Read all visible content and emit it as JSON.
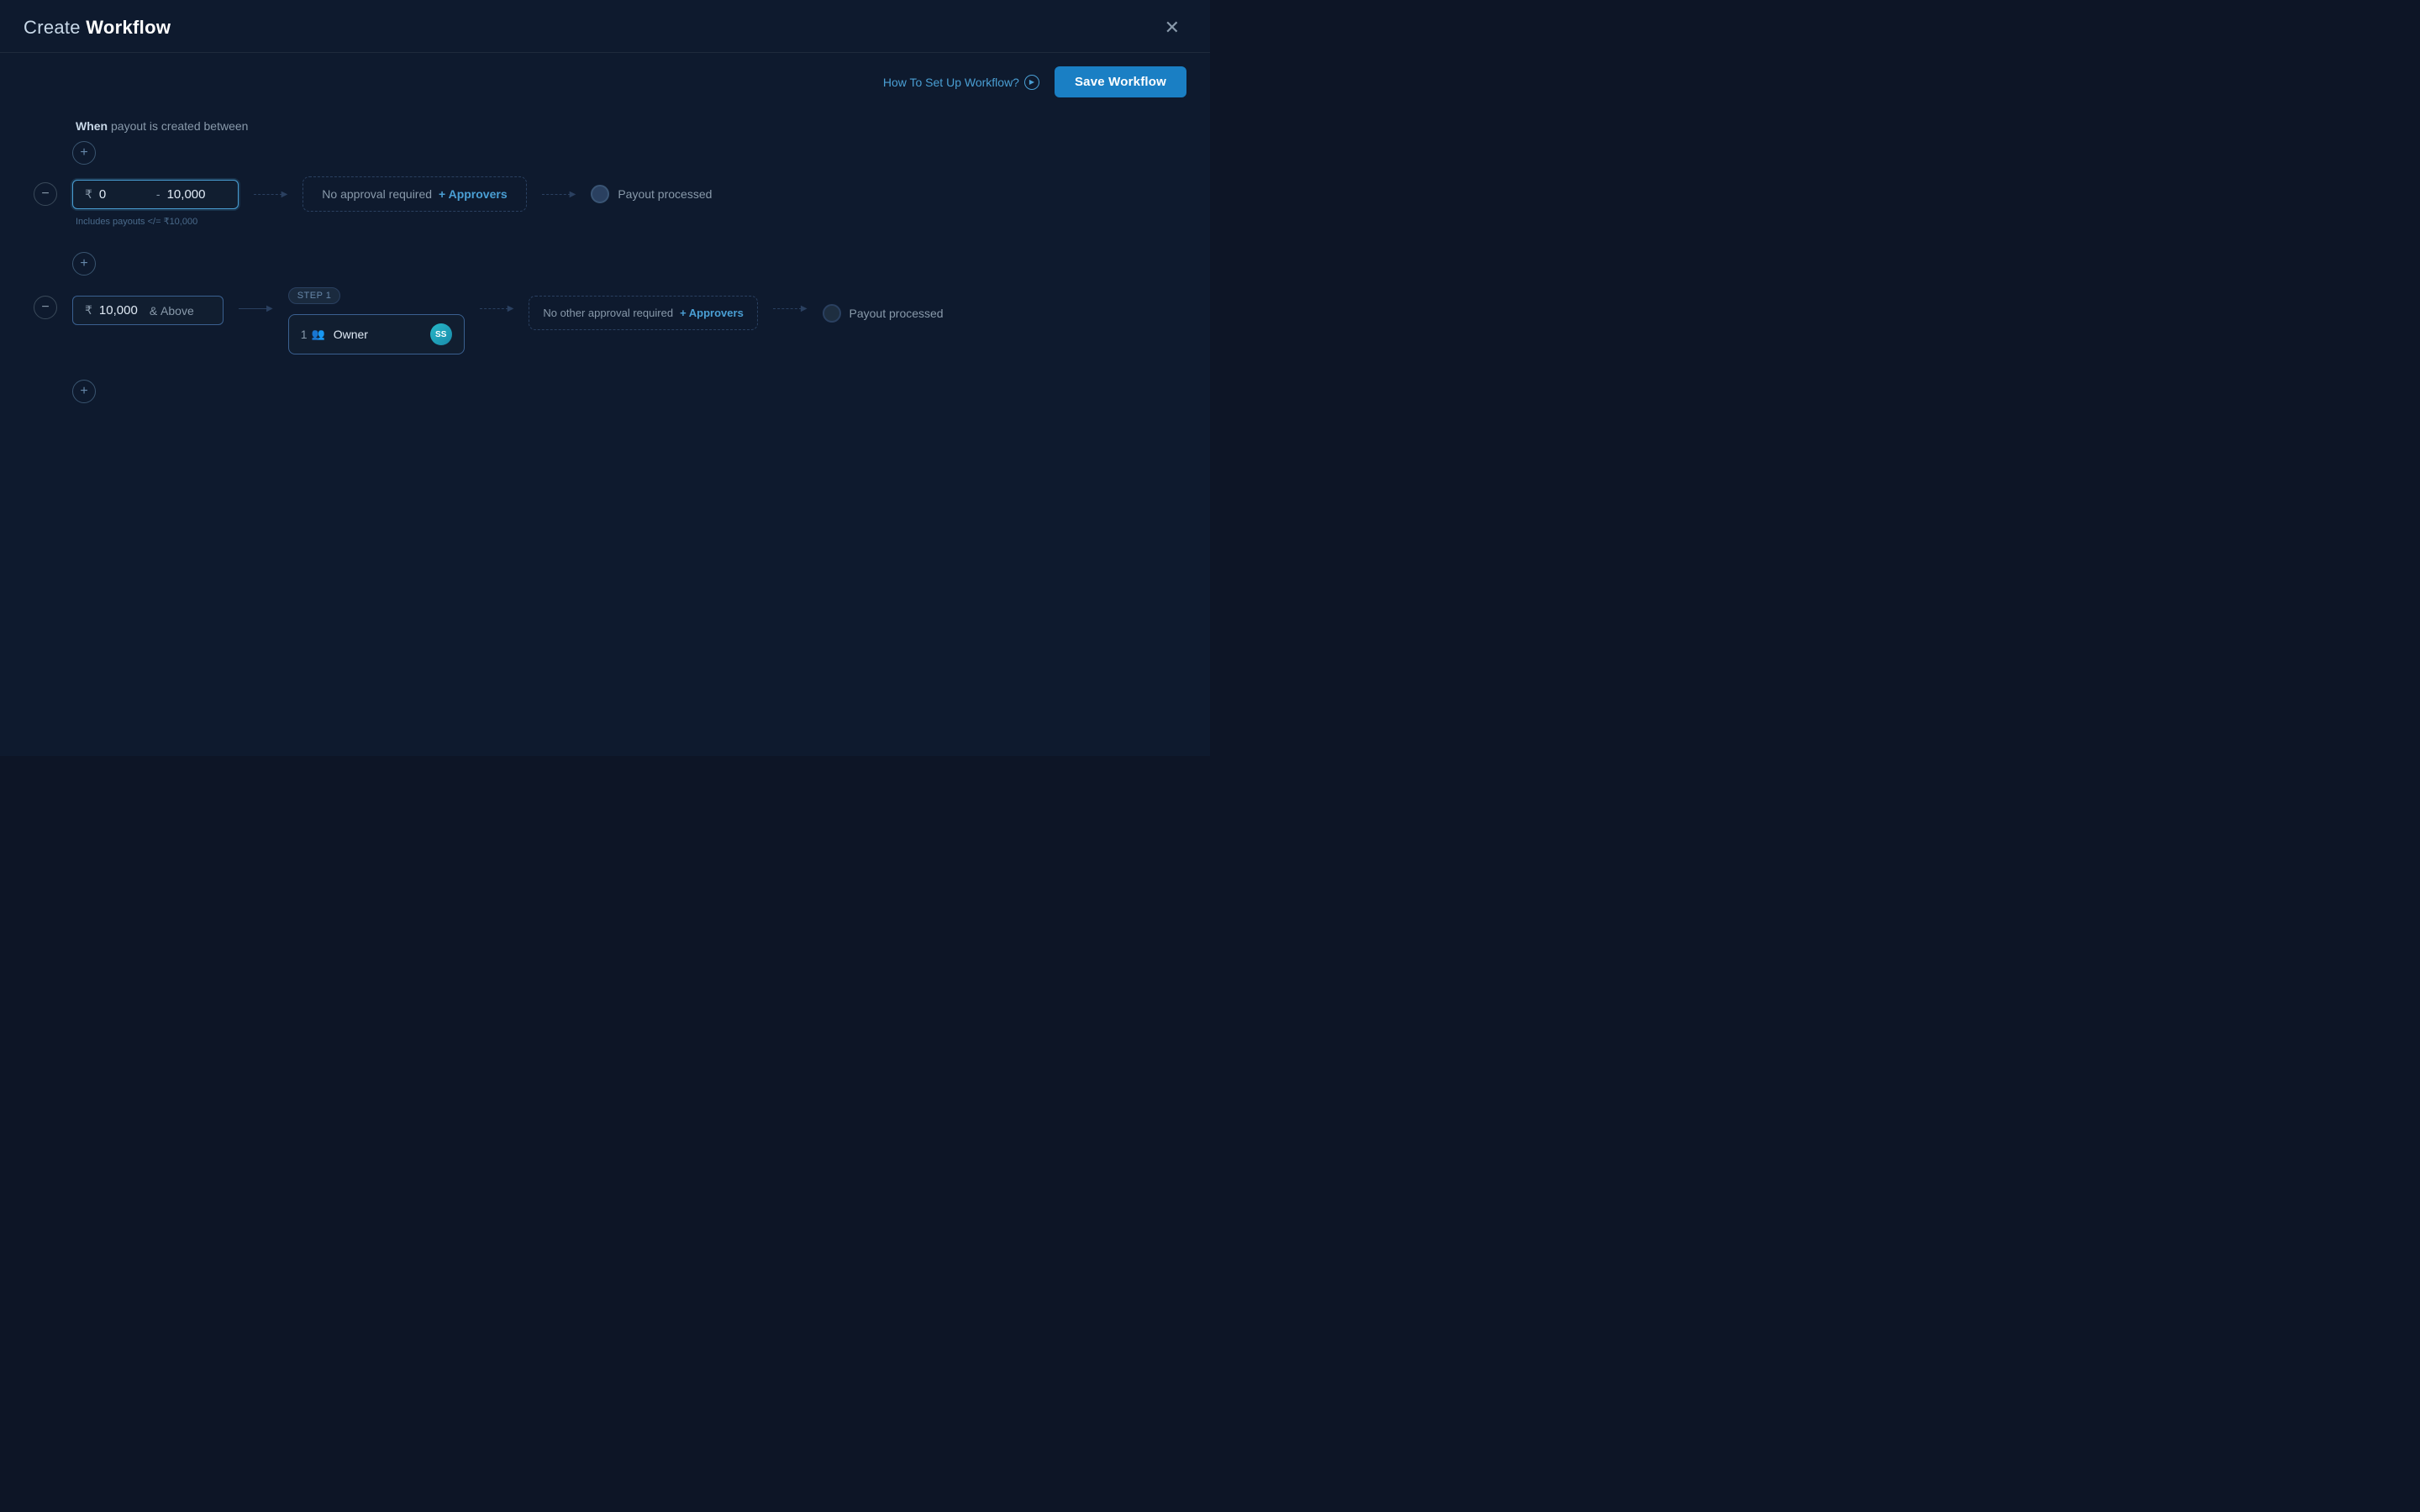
{
  "modal": {
    "title_normal": "Create ",
    "title_bold": "Workflow",
    "close_label": "✕"
  },
  "toolbar": {
    "how_to_label": "How To Set Up Workflow?",
    "save_label": "Save Workflow"
  },
  "workflow": {
    "when_prefix": "When",
    "when_suffix": " payout is created between",
    "row1": {
      "currency": "₹",
      "from_value": "0",
      "separator": "-",
      "to_value": "10,000",
      "hint": "Includes payouts </= ₹10,000",
      "no_approval_text": "No approval required",
      "add_approvers_label": "+ Approvers",
      "payout_text": "Payout processed"
    },
    "row2": {
      "currency": "₹",
      "from_value": "10,000",
      "above_label": "&  Above",
      "step_label": "STEP 1",
      "approver_count": "1",
      "approver_name": "Owner",
      "avatar_initials": "SS",
      "no_other_text": "No other approval required",
      "add_approvers_label": "+ Approvers",
      "payout_text": "Payout processed"
    }
  }
}
